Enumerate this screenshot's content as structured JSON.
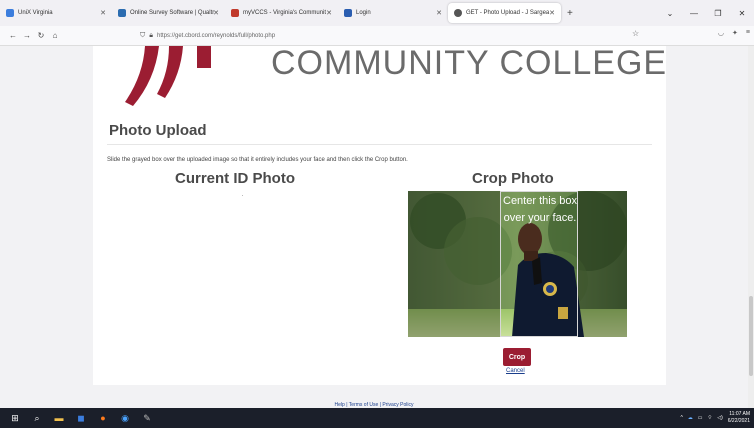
{
  "browser": {
    "tabs": [
      {
        "title": "UniX Virginia",
        "color": "#3b7ddd"
      },
      {
        "title": "Online Survey Software | Qualtr",
        "color": "#2b6cb0"
      },
      {
        "title": "myVCCS - Virginia's Communit",
        "color": "#c0392b"
      },
      {
        "title": "Login",
        "color": "#2a5db0"
      },
      {
        "title": "GET - Photo Upload - J Sargea",
        "color": "#555555"
      }
    ],
    "url": "https://get.cbord.com/reynolds/full/photo.php"
  },
  "page": {
    "college_wordmark": "COMMUNITY COLLEGE",
    "heading": "Photo Upload",
    "instructions": "Slide the grayed box over the uploaded image so that it entirely includes your face and then click the Crop button.",
    "current_photo_heading": "Current ID Photo",
    "crop_photo_heading": "Crop Photo",
    "crop_box_text": "Center this box over your face.",
    "crop_button": "Crop",
    "cancel_link": "Cancel",
    "footer": "Help | Terms of Use | Privacy Policy",
    "brand_color": "#9b1d32"
  },
  "taskbar": {
    "time": "11:07 AM",
    "date": "6/22/2021"
  }
}
